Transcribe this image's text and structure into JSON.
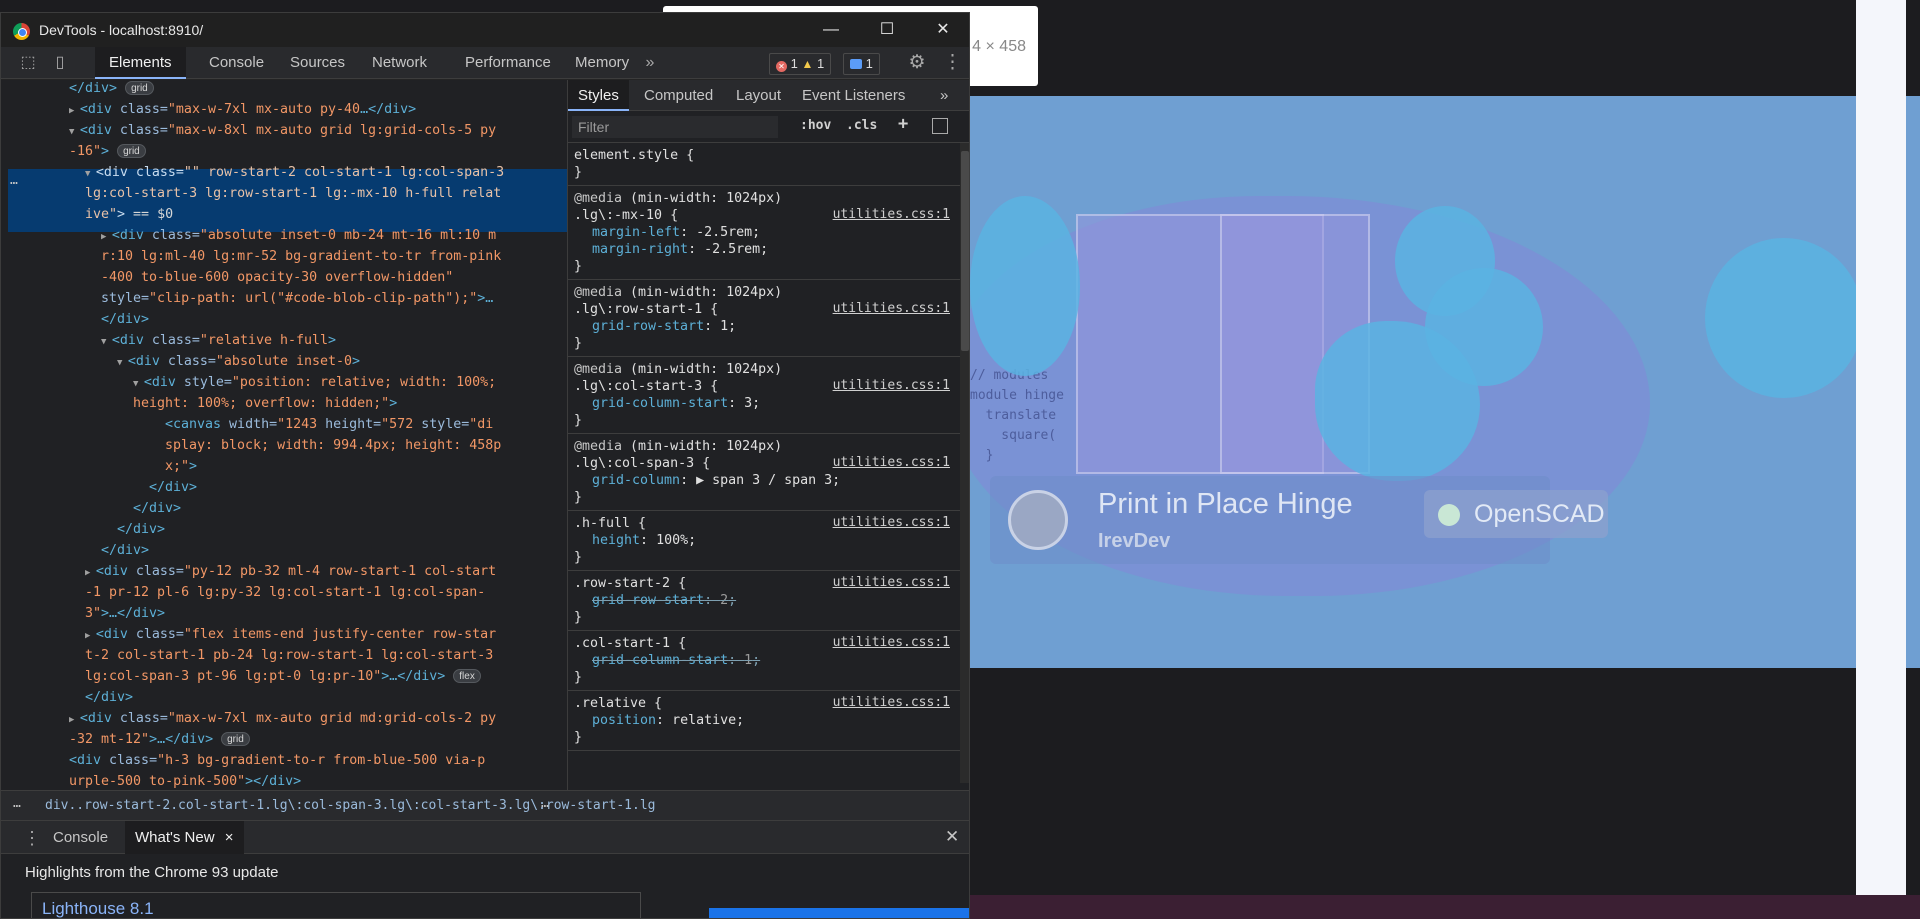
{
  "window": {
    "title": "DevTools - localhost:8910/",
    "minimize": "—",
    "maximize": "☐",
    "close": "✕"
  },
  "toolbar": {
    "tabs": [
      "Elements",
      "Console",
      "Sources",
      "Network",
      "Performance",
      "Memory"
    ],
    "more": "»",
    "errors": "1",
    "warnings": "1",
    "messages": "1",
    "settings_icon": "⚙",
    "menu_icon": "⋮"
  },
  "elements": {
    "lines": [
      {
        "indent": 7,
        "tri": "",
        "html": "</div>",
        "pill": "grid"
      },
      {
        "indent": 7,
        "tri": "▶",
        "open": "div",
        "attrs": [
          [
            "class",
            "max-w-7xl mx-auto py-40"
          ]
        ],
        "tail": "…</div>"
      },
      {
        "indent": 7,
        "tri": "▼",
        "open": "div",
        "attrs": [
          [
            "class",
            "max-w-8xl mx-auto grid lg:grid-cols-5 py"
          ]
        ]
      },
      {
        "indent": 7,
        "cont": true,
        "valtext": "-16\"",
        "close": ">",
        "pill": "grid"
      },
      {
        "indent": 9,
        "tri": "▼",
        "open": "div",
        "attrs": [
          [
            "class",
            "\" row-start-2 col-start-1 lg:col-span-3"
          ]
        ],
        "selected": true
      },
      {
        "indent": 9,
        "cont": true,
        "valtext": "lg:col-start-3 lg:row-start-1 lg:-mx-10 h-full relat",
        "selected": true
      },
      {
        "indent": 9,
        "cont": true,
        "valtext": "ive\"",
        "close": ">",
        "eq": " == $0",
        "selected": true
      },
      {
        "indent": 11,
        "tri": "▶",
        "open": "div",
        "attrs": [
          [
            "class",
            "absolute inset-0 mb-24 mt-16 ml:10 m"
          ]
        ]
      },
      {
        "indent": 11,
        "cont": true,
        "valtext": "r:10 lg:ml-40 lg:mr-52 bg-gradient-to-tr from-pink"
      },
      {
        "indent": 11,
        "cont": true,
        "valtext": "-400 to-blue-600 opacity-30 overflow-hidden\""
      },
      {
        "indent": 11,
        "cont": true,
        "attrtext": "style=",
        "valtext": "\"clip-path: url(\"#code-blob-clip-path\");\"",
        "close": ">…"
      },
      {
        "indent": 11,
        "close_tag": "</div>"
      },
      {
        "indent": 11,
        "tri": "▼",
        "open": "div",
        "attrs": [
          [
            "class",
            "relative h-full"
          ]
        ],
        "close": ">"
      },
      {
        "indent": 13,
        "tri": "▼",
        "open": "div",
        "attrs": [
          [
            "class",
            "absolute inset-0"
          ]
        ],
        "close": ">"
      },
      {
        "indent": 15,
        "tri": "▼",
        "open": "div",
        "attrs": [
          [
            "style",
            "position: relative; width: 100%;"
          ]
        ]
      },
      {
        "indent": 15,
        "cont": true,
        "valtext": "height: 100%; overflow: hidden;\"",
        "close": ">"
      },
      {
        "indent": 19,
        "open": "canvas",
        "attrs": [
          [
            "width",
            "1243"
          ],
          [
            "height",
            "572"
          ]
        ],
        "attrtext2": " style=",
        "valtext2": "\"di"
      },
      {
        "indent": 19,
        "cont": true,
        "valtext": "splay: block; width: 994.4px; height: 458p"
      },
      {
        "indent": 19,
        "cont": true,
        "valtext": "x;\"",
        "close": ">"
      },
      {
        "indent": 17,
        "close_tag": "</div>"
      },
      {
        "indent": 15,
        "close_tag": "</div>"
      },
      {
        "indent": 13,
        "close_tag": "</div>"
      },
      {
        "indent": 11,
        "close_tag": "</div>"
      },
      {
        "indent": 9,
        "tri": "▶",
        "open": "div",
        "attrs": [
          [
            "class",
            "py-12 pb-32 ml-4 row-start-1 col-start"
          ]
        ]
      },
      {
        "indent": 9,
        "cont": true,
        "valtext": "-1 pr-12 pl-6 lg:py-32 lg:col-start-1 lg:col-span-"
      },
      {
        "indent": 9,
        "cont": true,
        "valtext": "3\"",
        "close": ">…</div>"
      },
      {
        "indent": 9,
        "tri": "▶",
        "open": "div",
        "attrs": [
          [
            "class",
            "flex items-end justify-center row-star"
          ]
        ]
      },
      {
        "indent": 9,
        "cont": true,
        "valtext": "t-2 col-start-1 pb-24 lg:row-start-1 lg:col-start-3"
      },
      {
        "indent": 9,
        "cont": true,
        "valtext": "lg:col-span-3 pt-96 lg:pt-0 lg:pr-10\"",
        "close": ">…</div>",
        "pill": "flex"
      },
      {
        "indent": 9,
        "close_tag": "</div>"
      },
      {
        "indent": 7,
        "tri": "▶",
        "open": "div",
        "attrs": [
          [
            "class",
            "max-w-7xl mx-auto grid md:grid-cols-2 py"
          ]
        ]
      },
      {
        "indent": 7,
        "cont": true,
        "valtext": "-32 mt-12\"",
        "close": ">…</div>",
        "pill": "grid"
      },
      {
        "indent": 7,
        "open": "div",
        "attrs": [
          [
            "class",
            "h-3 bg-gradient-to-r from-blue-500 via-p"
          ]
        ]
      },
      {
        "indent": 7,
        "cont": true,
        "valtext": "urple-500 to-pink-500\"",
        "close": "></div>"
      }
    ],
    "selected_ellipsis": "…"
  },
  "styles": {
    "tabs": [
      "Styles",
      "Computed",
      "Layout",
      "Event Listeners"
    ],
    "more": "»",
    "filter_placeholder": "Filter",
    "hov": ":hov",
    "cls": ".cls",
    "add": "+",
    "rules": [
      {
        "media": "",
        "selector": "element.style {",
        "link": "",
        "props": []
      },
      {
        "media": "(min-width: 1024px)",
        "selector": ".lg\\:-mx-10 {",
        "link": "utilities.css:1",
        "props": [
          [
            "margin-left",
            "-2.5rem",
            false
          ],
          [
            "margin-right",
            "-2.5rem",
            false
          ]
        ]
      },
      {
        "media": "(min-width: 1024px)",
        "selector": ".lg\\:row-start-1 {",
        "link": "utilities.css:1",
        "props": [
          [
            "grid-row-start",
            "1",
            false
          ]
        ]
      },
      {
        "media": "(min-width: 1024px)",
        "selector": ".lg\\:col-start-3 {",
        "link": "utilities.css:1",
        "props": [
          [
            "grid-column-start",
            "3",
            false
          ]
        ]
      },
      {
        "media": "(min-width: 1024px)",
        "selector": ".lg\\:col-span-3 {",
        "link": "utilities.css:1",
        "props": [
          [
            "grid-column",
            "▶ span 3 / span 3",
            false
          ]
        ]
      },
      {
        "media": "",
        "selector": ".h-full {",
        "link": "utilities.css:1",
        "props": [
          [
            "height",
            "100%",
            false
          ]
        ]
      },
      {
        "media": "",
        "selector": ".row-start-2 {",
        "link": "utilities.css:1",
        "props": [
          [
            "grid-row-start",
            "2",
            true
          ]
        ]
      },
      {
        "media": "",
        "selector": ".col-start-1 {",
        "link": "utilities.css:1",
        "props": [
          [
            "grid-column-start",
            "1",
            true
          ]
        ]
      },
      {
        "media": "",
        "selector": ".relative {",
        "link": "utilities.css:1",
        "props": [
          [
            "position",
            "relative",
            false
          ]
        ]
      }
    ]
  },
  "breadcrumb": "div..row-start-2.col-start-1.lg\\:col-span-3.lg\\:col-start-3.lg\\:row-start-1.lg",
  "drawer": {
    "tabs": [
      "Console",
      "What's New"
    ],
    "close_tab": "×",
    "close_drawer": "✕",
    "headline": "Highlights from the Chrome 93 update",
    "card_title": "Lighthouse 8.1"
  },
  "page": {
    "card_title": "Print in Place Hinge",
    "card_user": "IrevDev",
    "card_tag": "OpenSCAD",
    "tooltip": "4 × 458",
    "code_text": "// modules\nmodule hinge\n  translate\n    square(\n  }"
  },
  "colors": {
    "accent": "#8ab4f8",
    "selected": "#063b70",
    "banner": "#6f9fd2"
  }
}
